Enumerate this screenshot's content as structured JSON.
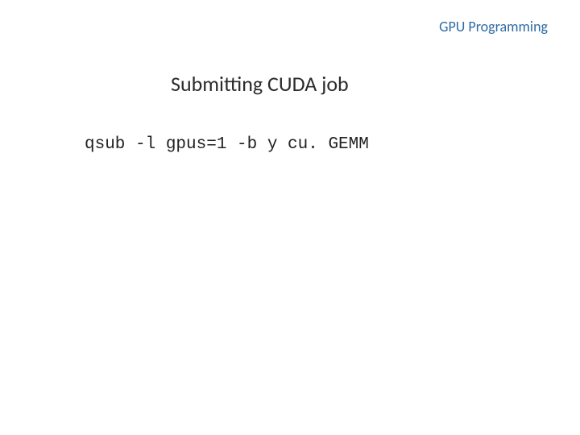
{
  "header": {
    "label": "GPU Programming"
  },
  "slide": {
    "title": "Submitting CUDA job"
  },
  "code": {
    "command": "qsub -l gpus=1 -b y cu. GEMM"
  }
}
